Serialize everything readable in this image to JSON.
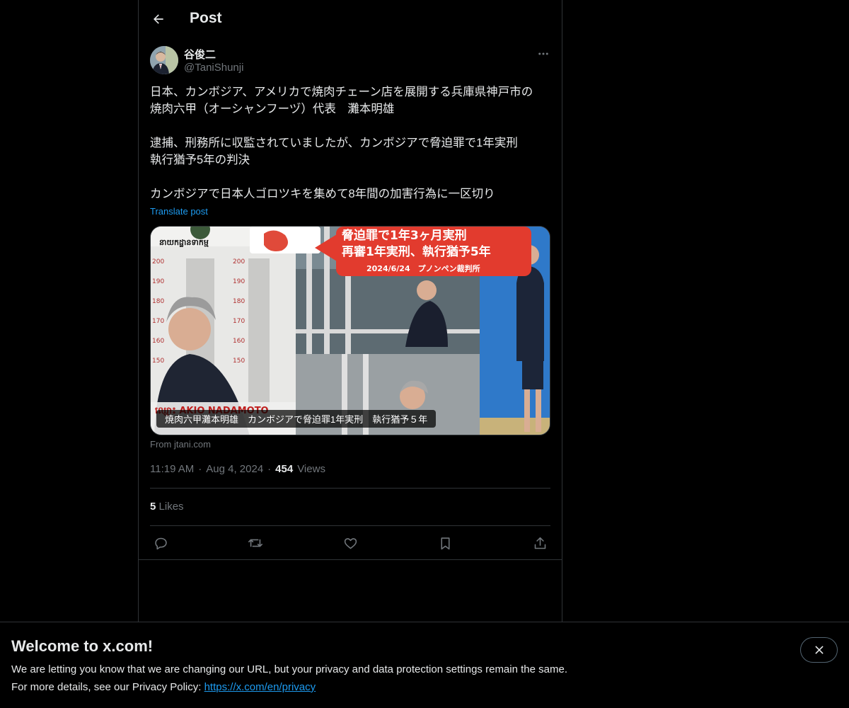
{
  "header": {
    "title": "Post"
  },
  "author": {
    "name": "谷俊二",
    "handle": "@TaniShunji"
  },
  "post": {
    "lines": [
      "日本、カンボジア、アメリカで焼肉チェーン店を展開する兵庫県神戸市の",
      "焼肉六甲（オーシャンフーヅ）代表　灘本明雄",
      "",
      "逮捕、刑務所に収監されていましたが、カンボジアで脅迫罪で1年実刑",
      "執行猶予5年の判決",
      "",
      "カンボジアで日本人ゴロツキを集めて8年間の加害行為に一区切り"
    ],
    "translate_label": "Translate post"
  },
  "media": {
    "overlay_title_1": "脅迫罪で1年3ヶ月実刑",
    "overlay_title_2": "再審1年実刑、執行猶予5年",
    "overlay_date": "2024/6/24　プノンペン裁判所",
    "name_plate": "ឈ្មោះ AKIO NADAMOTO",
    "board_text": "នាយកដ្ឋានទាកម្ម",
    "caption": "焼肉六甲灘本明雄　カンボジアで脅迫罪1年実刑　執行猶予５年",
    "source": "From jtani.com"
  },
  "meta": {
    "time": "11:19 AM",
    "date": "Aug 4, 2024",
    "views_count": "454",
    "views_label": "Views",
    "dot": "·"
  },
  "stats": {
    "likes_count": "5",
    "likes_label": "Likes"
  },
  "banner": {
    "title": "Welcome to x.com!",
    "line1": "We are letting you know that we are changing our URL, but your privacy and data protection settings remain the same.",
    "line2_prefix": "For more details, see our Privacy Policy: ",
    "link": "https://x.com/en/privacy"
  },
  "icons": [
    "back-arrow-icon",
    "more-dots-icon",
    "reply-icon",
    "repost-icon",
    "like-icon",
    "bookmark-icon",
    "share-icon",
    "close-icon"
  ],
  "colors": {
    "background": "#000000",
    "text": "#e7e9ea",
    "muted": "#71767b",
    "accent": "#1d9bf0",
    "border": "#2f3336"
  }
}
